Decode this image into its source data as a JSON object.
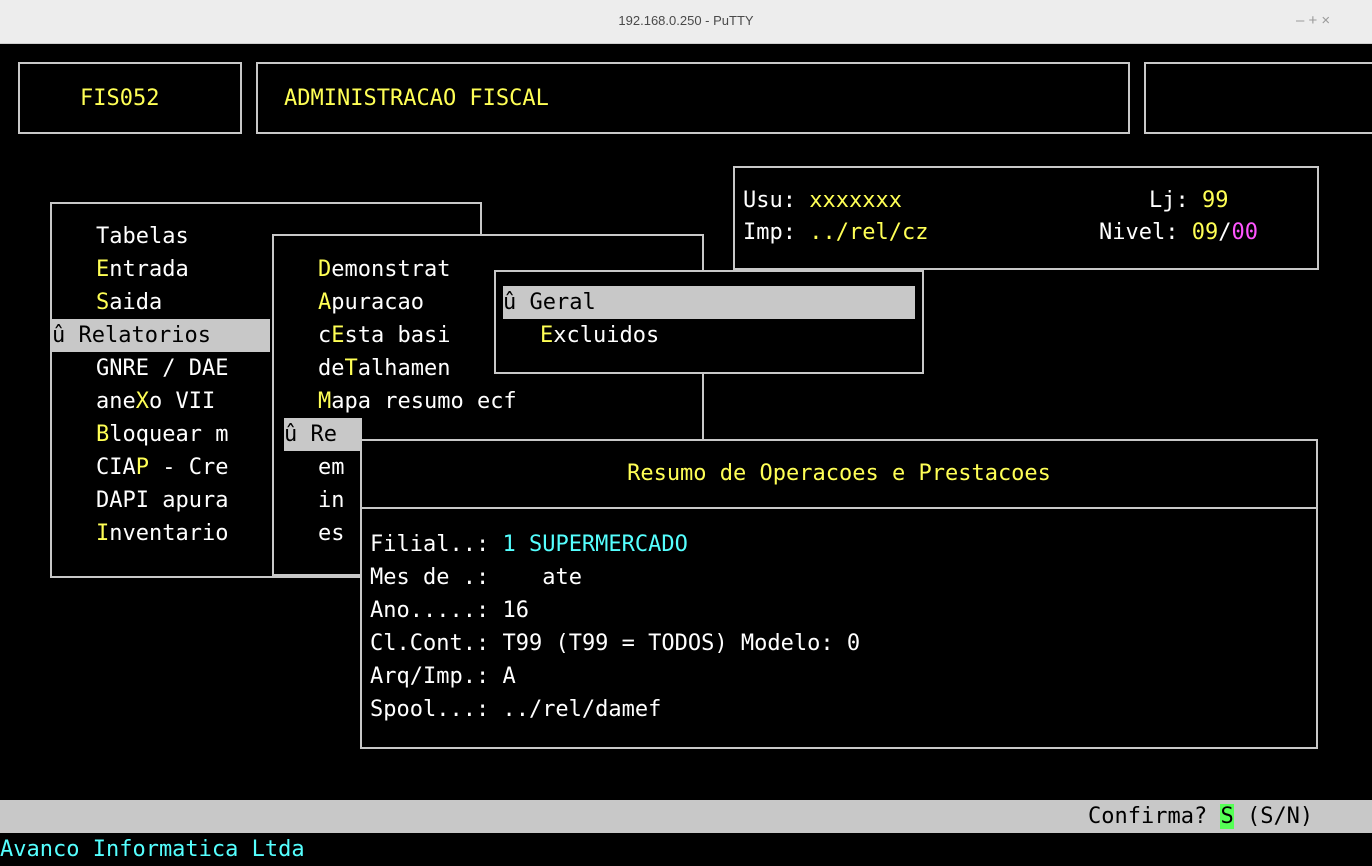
{
  "window": {
    "title": "192.168.0.250 - PuTTY",
    "controls": "–  +  ×"
  },
  "header": {
    "code": "FIS052",
    "title": "ADMINISTRACAO FISCAL"
  },
  "user_panel": {
    "usu_label": "Usu: ",
    "usu_value": "xxxxxxx",
    "lj_label": "Lj: ",
    "lj_value": "99",
    "imp_label": "Imp: ",
    "imp_value": "../rel/cz",
    "nivel_label": "Nivel: ",
    "nivel_value_a": "09",
    "nivel_sep": "/",
    "nivel_value_b": "00"
  },
  "main_menu": {
    "items": [
      {
        "hot": "",
        "rest": "Tabelas"
      },
      {
        "hot": "E",
        "rest": "ntrada"
      },
      {
        "hot": "S",
        "rest": "aida"
      },
      {
        "marker": "û ",
        "hot": "",
        "rest": "Relatorios"
      },
      {
        "hot": "",
        "rest": "GNRE / DAE"
      },
      {
        "pre": "ane",
        "hot": "X",
        "rest": "o VII"
      },
      {
        "hot": "B",
        "rest": "loquear m"
      },
      {
        "pre": "CIA",
        "hot": "P",
        "rest": " - Cre"
      },
      {
        "hot": "",
        "rest": "DAPI apura"
      },
      {
        "hot": "I",
        "rest": "nventario"
      }
    ]
  },
  "sub_menu": {
    "items": [
      {
        "hot": "D",
        "rest": "emonstrat"
      },
      {
        "hot": "A",
        "rest": "puracao"
      },
      {
        "pre": "c",
        "hot": "E",
        "rest": "sta basi"
      },
      {
        "pre": "de",
        "hot": "T",
        "rest": "alhamen"
      },
      {
        "hot": "M",
        "rest": "apa resumo ecf"
      },
      {
        "marker": "û ",
        "hot": "",
        "rest": "Re"
      },
      {
        "hot": "",
        "rest": "em"
      },
      {
        "hot": "",
        "rest": "in"
      },
      {
        "hot": "",
        "rest": "es"
      }
    ]
  },
  "popup_menu": {
    "items": [
      {
        "marker": "û ",
        "label": "Geral"
      },
      {
        "hot": "E",
        "rest": "xcluidos"
      }
    ]
  },
  "form": {
    "title": "Resumo de Operacoes e Prestacoes",
    "filial_label": "Filial..: ",
    "filial_num": "1",
    "filial_name": "SUPERMERCADO",
    "mes_label": "Mes de .:",
    "mes_ate": "ate",
    "ano_label": "Ano.....: ",
    "ano_value": "16",
    "clcont_label": "Cl.Cont.: ",
    "clcont_value": "T99",
    "clcont_hint": " (T99 = TODOS) Modelo: ",
    "modelo_value": "0",
    "arq_label": "Arq/Imp.: ",
    "arq_value": "A",
    "spool_label": "Spool...: ",
    "spool_value": "../rel/damef"
  },
  "status": {
    "prompt": "Confirma? ",
    "answer": "S",
    "options": " (S/N)"
  },
  "footer": {
    "company": "Avanco Informatica Ltda"
  },
  "colors": {
    "hotkey": "#ffff55",
    "value": "#55ffff",
    "accent": "#ff55ff",
    "confirm_bg": "#55ff55",
    "bar": "#c8c8c8"
  }
}
